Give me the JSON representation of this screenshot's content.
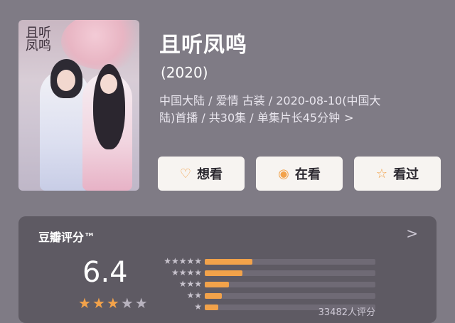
{
  "movie": {
    "title": "且听凤鸣",
    "year": "(2020)",
    "meta_line1": "中国大陆 / 爱情 古装 / 2020-08-10(中国大",
    "meta_line2": "陆)首播 / 共30集 / 单集片长45分钟",
    "meta_chevron": ">"
  },
  "actions": {
    "want": {
      "label": "想看",
      "icon": "heart-plus-icon"
    },
    "watching": {
      "label": "在看",
      "icon": "target-icon"
    },
    "watched": {
      "label": "看过",
      "icon": "star-icon"
    }
  },
  "rating": {
    "label": "豆瓣评分™",
    "chevron": ">",
    "score": "6.4",
    "stars_filled": 3,
    "stars_total": 5,
    "count_text": "33482人评分",
    "distribution": [
      {
        "stars": "★★★★★",
        "percent": 28
      },
      {
        "stars": "★★★★",
        "percent": 22
      },
      {
        "stars": "★★★",
        "percent": 14
      },
      {
        "stars": "★★",
        "percent": 10
      },
      {
        "stars": "★",
        "percent": 8
      }
    ]
  },
  "colors": {
    "background": "#7f7b85",
    "card": "#5e5a63",
    "accent": "#f2a24a",
    "button": "#f7f4f1"
  }
}
